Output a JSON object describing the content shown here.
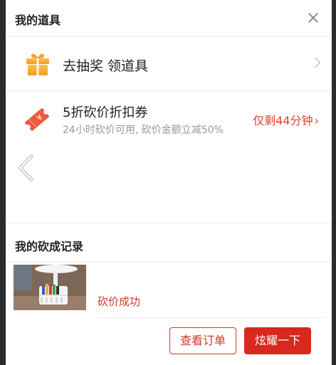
{
  "header": {
    "title": "我的道具"
  },
  "draw_row": {
    "label": "去抽奖 领道具"
  },
  "coupon": {
    "title": "5折砍价折扣券",
    "subtitle": "24小时砍价可用, 砍价金额立减50%",
    "remaining": "仅剩44分钟",
    "ticket_symbol": "¥"
  },
  "records": {
    "title": "我的砍成记录",
    "items": [
      {
        "status": "砍价成功",
        "view_order_label": "查看订单",
        "show_off_label": "炫耀一下"
      }
    ]
  },
  "colors": {
    "accent": "#d9281e",
    "remaining_text": "#e0452b",
    "gift_orange": "#f7a531"
  },
  "icons": {
    "close": "close-icon",
    "gift": "gift-icon",
    "ticket": "ticket-icon",
    "prev": "chevron-left-icon",
    "next": "chevron-right-icon"
  }
}
